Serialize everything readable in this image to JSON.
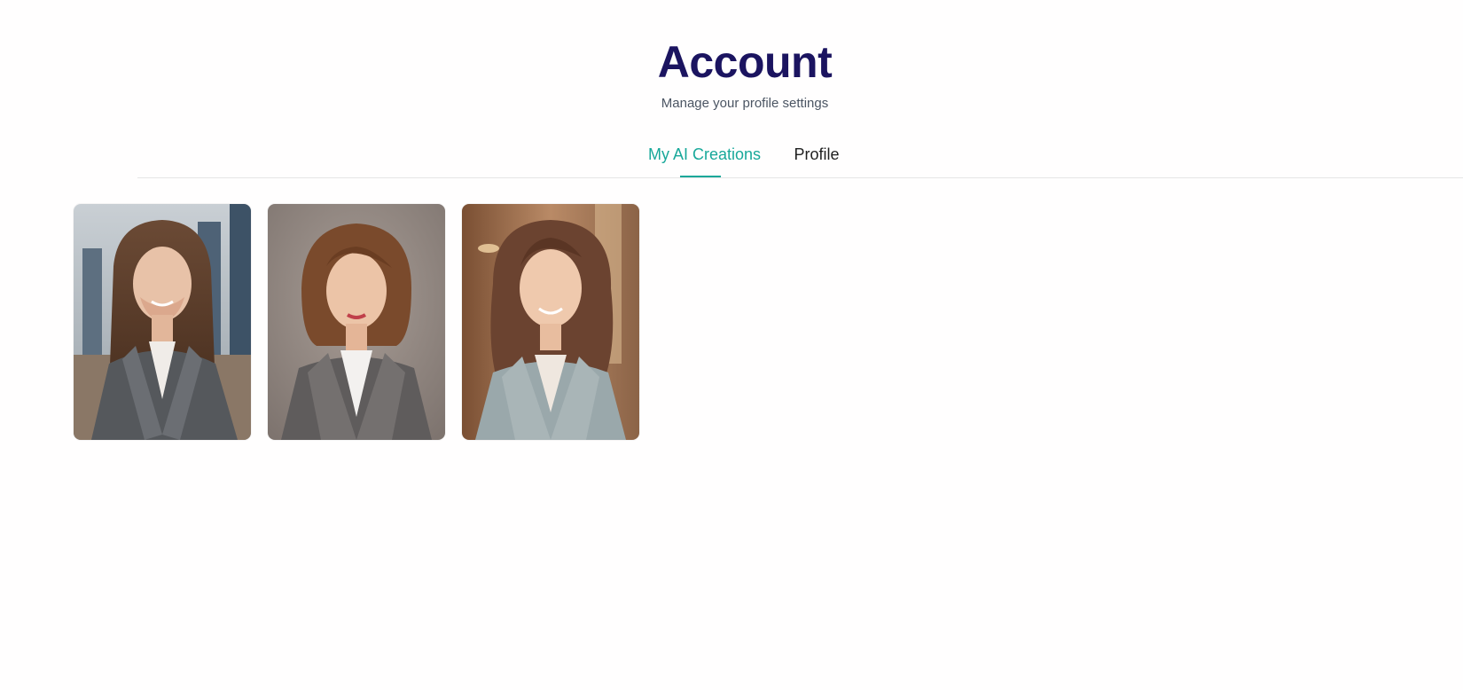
{
  "header": {
    "title": "Account",
    "subtitle": "Manage your profile settings"
  },
  "tabs": [
    {
      "label": "My AI Creations",
      "active": true
    },
    {
      "label": "Profile",
      "active": false
    }
  ],
  "colors": {
    "title": "#1b1460",
    "accent": "#18a89a",
    "subtitle": "#4b5563",
    "divider": "#e6e6e6"
  },
  "gallery": {
    "items": [
      {
        "kind": "ai-portrait",
        "background": "city-skyline"
      },
      {
        "kind": "ai-portrait",
        "background": "studio-gray"
      },
      {
        "kind": "ai-portrait",
        "background": "warm-office"
      }
    ]
  }
}
